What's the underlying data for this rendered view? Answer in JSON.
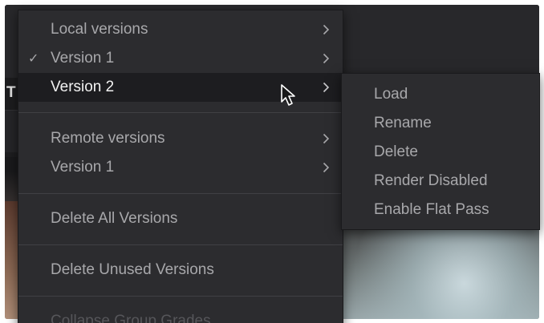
{
  "context_menu": {
    "items": [
      {
        "label": "Local versions",
        "checked": false,
        "submenu": true,
        "highlighted": false,
        "disabled": false
      },
      {
        "label": "Version 1",
        "checked": true,
        "submenu": true,
        "highlighted": false,
        "disabled": false
      },
      {
        "label": "Version 2",
        "checked": false,
        "submenu": true,
        "highlighted": true,
        "disabled": false
      },
      {
        "label": "Remote versions",
        "checked": false,
        "submenu": true,
        "highlighted": false,
        "disabled": false
      },
      {
        "label": "Version 1",
        "checked": false,
        "submenu": true,
        "highlighted": false,
        "disabled": false
      },
      {
        "label": "Delete All Versions",
        "checked": false,
        "submenu": false,
        "highlighted": false,
        "disabled": false
      },
      {
        "label": "Delete Unused Versions",
        "checked": false,
        "submenu": false,
        "highlighted": false,
        "disabled": false
      },
      {
        "label": "Collapse Group Grades",
        "checked": false,
        "submenu": false,
        "highlighted": false,
        "disabled": true
      }
    ],
    "checkmark_glyph": "✓"
  },
  "submenu": {
    "items": [
      {
        "label": "Load"
      },
      {
        "label": "Rename"
      },
      {
        "label": "Delete"
      },
      {
        "label": "Render Disabled"
      },
      {
        "label": "Enable Flat Pass"
      }
    ]
  },
  "background_app": {
    "tab_letter": "T"
  },
  "colors": {
    "menu_bg": "#2c2c2f",
    "highlight_bg": "#1d1d20",
    "text": "#a8a8ab",
    "highlight_text": "#f2f2f2",
    "disabled_text": "#56565a"
  },
  "icons": {
    "submenu_arrow": "chevron-right-icon",
    "cursor": "mouse-pointer-icon"
  }
}
